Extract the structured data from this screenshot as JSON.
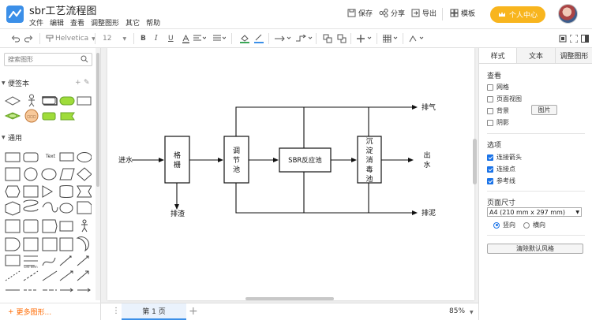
{
  "app": {
    "title": "sbr工艺流程图",
    "menu": [
      "文件",
      "编辑",
      "查看",
      "调整图形",
      "其它",
      "帮助"
    ],
    "actions": {
      "save": "保存",
      "share": "分享",
      "export": "导出",
      "templates": "模板"
    },
    "user_center": "个人中心"
  },
  "toolbar": {
    "font_family": "Helvetica",
    "font_size": "12"
  },
  "sidebar": {
    "search_placeholder": "搜索图形",
    "sections": {
      "scratchpad": "便签本",
      "general": "通用"
    },
    "text_shape_label": "Text",
    "list_item_label": "List Item",
    "more_shapes": "更多图形..."
  },
  "diagram": {
    "inlet": "进水",
    "grille": "格栅",
    "tank": "调节池",
    "sbr": "SBR反应池",
    "disinfect": "沉淀消毒池",
    "outlet": "出水",
    "exhaust": "排气",
    "slag": "排渣",
    "sludge": "排泥"
  },
  "bottombar": {
    "page_tab": "第 1 页",
    "zoom": "85%"
  },
  "rpanel": {
    "tabs": [
      "样式",
      "文本",
      "调整图形"
    ],
    "view": {
      "title": "查看",
      "options": [
        {
          "label": "网格",
          "checked": false
        },
        {
          "label": "页面视图",
          "checked": false
        },
        {
          "label": "背景",
          "checked": false
        },
        {
          "label": "阴影",
          "checked": false
        }
      ],
      "image_button": "图片"
    },
    "options": {
      "title": "选项",
      "items": [
        {
          "label": "连接箭头",
          "checked": true
        },
        {
          "label": "连接点",
          "checked": true
        },
        {
          "label": "参考线",
          "checked": true
        }
      ]
    },
    "page_size": {
      "title": "页面尺寸",
      "selected": "A4 (210 mm x 297 mm)",
      "portrait": "竖向",
      "landscape": "横向"
    },
    "reset_button": "清除默认风格"
  },
  "colors": {
    "accent": "#3b8fe8",
    "user_center_bg": "#f8b51e",
    "more_shapes": "#ff6a00"
  }
}
